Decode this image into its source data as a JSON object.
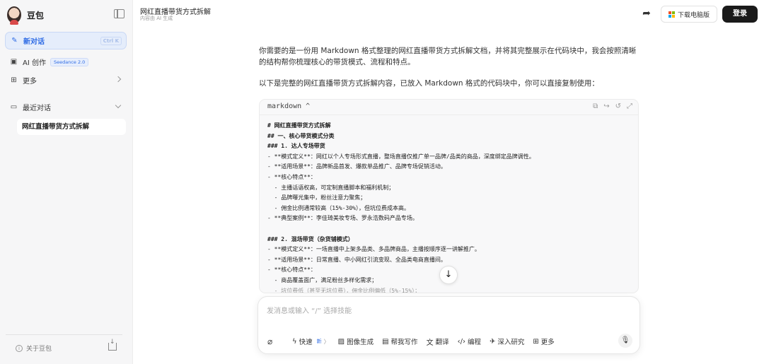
{
  "app": {
    "name": "豆包"
  },
  "sidebar": {
    "new_chat": {
      "label": "新对话",
      "shortcut": "Ctrl K"
    },
    "ai_create": {
      "label": "AI 创作",
      "badge": "Seedance 2.0"
    },
    "more": {
      "label": "更多"
    },
    "recent": {
      "label": "最近对话"
    },
    "recent_items": [
      {
        "label": "网红直播带货方式拆解"
      }
    ],
    "about": {
      "label": "关于豆包"
    }
  },
  "header": {
    "title": "网红直播带货方式拆解",
    "subtitle": "内容由 AI 生成",
    "download_label": "下载电脑版",
    "login_label": "登录"
  },
  "message": {
    "p1": "你需要的是一份用 Markdown 格式整理的网红直播带货方式拆解文档，并将其完整展示在代码块中，我会按照清晰的结构帮你梳理核心的带货模式、流程和特点。",
    "p2": "以下是完整的网红直播带货方式拆解内容，已放入 Markdown 格式的代码块中，你可以直接复制使用："
  },
  "code_block": {
    "language": "markdown ^",
    "lines": [
      "# 网红直播带货方式拆解",
      "## 一、核心带货模式分类",
      "### 1. 达人专场带货",
      "- **模式定义**：网红以个人专场形式直播，整场直播仅推广单一品牌/品类的商品，深度绑定品牌调性。",
      "- **适用场景**：品牌新品首发、爆款单品推广、品牌专场促销活动。",
      "- **核心特点**：",
      "  - 主播话语权高，可定制直播脚本和福利机制；",
      "  - 品牌曝光集中，粉丝注意力聚焦；",
      "  - 佣金比例通常较高（15%-30%），但坑位费成本高。",
      "- **典型案例**：李佳琦美妆专场、罗永浩数码产品专场。",
      "",
      "### 2. 混场带货（杂货铺模式）",
      "- **模式定义**：一场直播中上架多品类、多品牌商品，主播按顺序逐一讲解推广。",
      "- **适用场景**：日常直播、中小网红引流变现、全品类电商直播间。",
      "- **核心特点**：",
      "  - 商品覆盖面广，满足粉丝多样化需求；",
      "  - 坑位费低（甚至无坑位费），佣金比例偏低（5%-15%）；"
    ]
  },
  "input": {
    "placeholder": "发消息或输入 “/” 选择技能"
  },
  "toolbar": {
    "quick": {
      "label": "快速",
      "tag": "新"
    },
    "image_gen": {
      "label": "图像生成"
    },
    "writing": {
      "label": "帮我写作"
    },
    "translate": {
      "label": "翻译"
    },
    "code": {
      "label": "编程"
    },
    "research": {
      "label": "深入研究"
    },
    "more": {
      "label": "更多"
    }
  },
  "colors": {
    "accent": "#2f6ce5",
    "sidebar_bg": "#f6f6f7",
    "login_bg": "#1a1a1a"
  }
}
